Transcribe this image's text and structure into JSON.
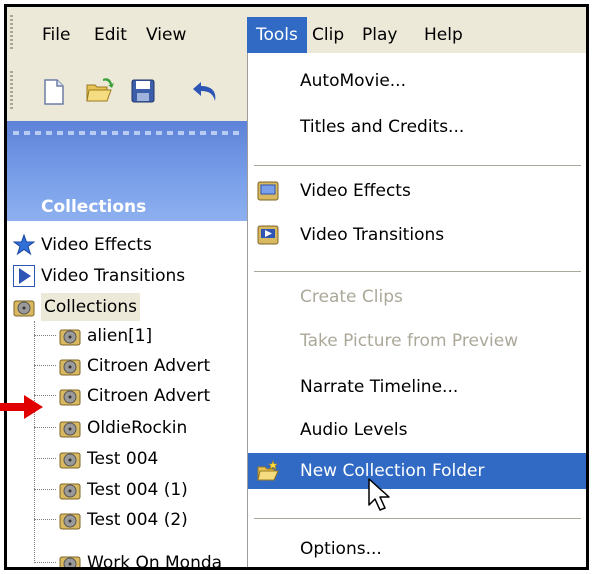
{
  "menubar": {
    "items": [
      {
        "label": "File"
      },
      {
        "label": "Edit"
      },
      {
        "label": "View"
      },
      {
        "label": "Tools"
      },
      {
        "label": "Clip"
      },
      {
        "label": "Play"
      },
      {
        "label": "Help"
      }
    ],
    "active": "Tools"
  },
  "panel": {
    "title": "Collections"
  },
  "tree": {
    "items": [
      {
        "label": "Video Effects",
        "icon": "star-icon"
      },
      {
        "label": "Video Transitions",
        "icon": "play-triangle-icon"
      },
      {
        "label": "Collections",
        "icon": "film-reel-icon"
      },
      {
        "label": "alien[1]",
        "icon": "film-reel-icon"
      },
      {
        "label": "Citroen Advert",
        "icon": "film-reel-icon"
      },
      {
        "label": "Citroen Advert",
        "icon": "film-reel-icon"
      },
      {
        "label": "OldieRockin",
        "icon": "film-reel-icon"
      },
      {
        "label": "Test 004",
        "icon": "film-reel-icon"
      },
      {
        "label": "Test 004 (1)",
        "icon": "film-reel-icon"
      },
      {
        "label": "Test 004 (2)",
        "icon": "film-reel-icon"
      },
      {
        "label": "Work On Monda",
        "icon": "film-reel-icon"
      }
    ]
  },
  "tools_menu": {
    "items": [
      {
        "label": "AutoMovie..."
      },
      {
        "label": "Titles and Credits..."
      },
      {
        "label": "Video Effects"
      },
      {
        "label": "Video Transitions"
      },
      {
        "label": "Create Clips",
        "disabled": true
      },
      {
        "label": "Take Picture from Preview",
        "disabled": true
      },
      {
        "label": "Narrate Timeline..."
      },
      {
        "label": "Audio Levels"
      },
      {
        "label": "New Collection Folder",
        "highlighted": true
      },
      {
        "label": "Options..."
      }
    ]
  },
  "colors": {
    "menu_highlight": "#316ac5",
    "menubar_bg": "#ece9d8",
    "panel_blue": "#6b8fe0",
    "disabled_text": "#aca899",
    "arrow_red": "#e00000"
  }
}
